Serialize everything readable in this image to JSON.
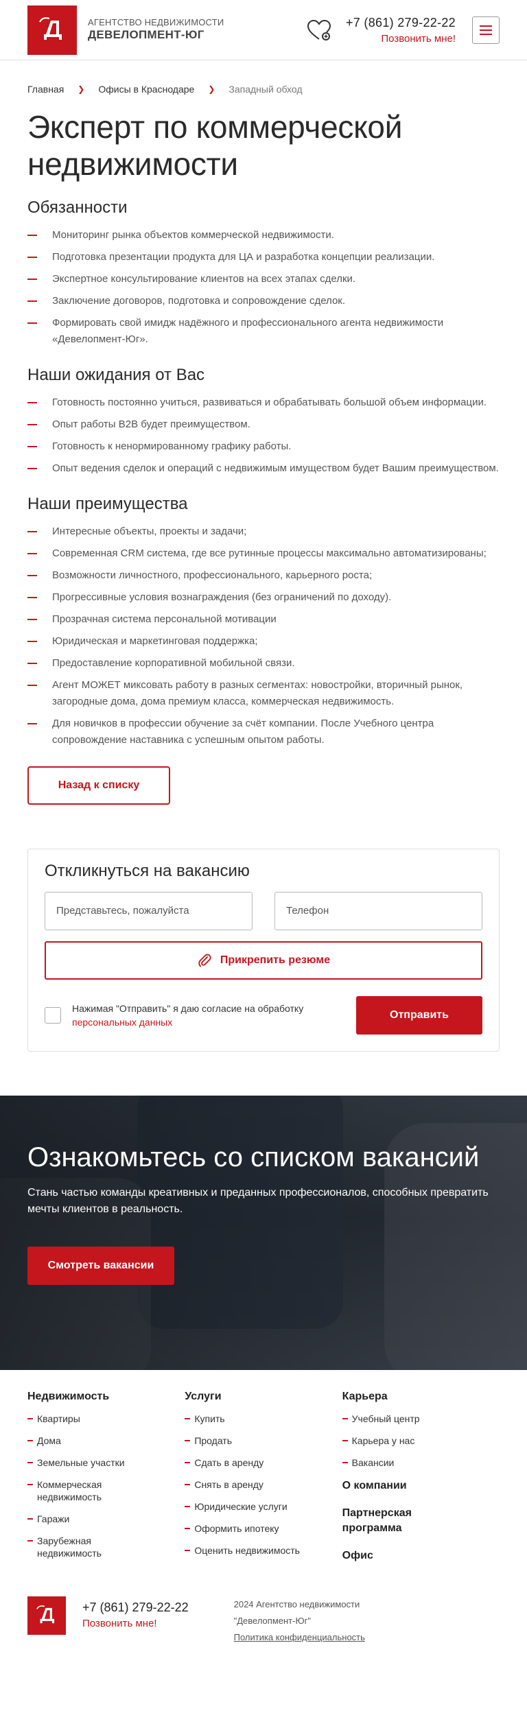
{
  "header": {
    "brand_top": "АГЕНТСТВО НЕДВИЖИМОСТИ",
    "brand_bottom": "ДЕВЕЛОПМЕНТ-ЮГ",
    "phone": "+7 (861) 279-22-22",
    "call_label": "Позвонить мне!",
    "icons": [
      "logo",
      "heart-icon",
      "menu-icon"
    ]
  },
  "breadcrumb": [
    {
      "label": "Главная"
    },
    {
      "label": "Офисы в Краснодаре"
    },
    {
      "label": "Западный обход"
    }
  ],
  "page_title": "Эксперт по коммерческой недвижимости",
  "sections": [
    {
      "title": "Обязанности",
      "items": [
        "Мониторинг рынка объектов коммерческой недвижимости.",
        "Подготовка презентации продукта для ЦА и разработка концепции реализации.",
        "Экспертное консультирование клиентов на всех этапах сделки.",
        "Заключение договоров, подготовка и сопровождение сделок.",
        "Формировать свой имидж надёжного и профессионального агента недвижимости «Девелопмент-Юг»."
      ]
    },
    {
      "title": "Наши ожидания от Вас",
      "items": [
        "Готовность постоянно учиться, развиваться и обрабатывать большой объем информации.",
        "Опыт работы B2B будет преимуществом.",
        "Готовность к ненормированному графику работы.",
        "Опыт ведения сделок и операций с недвижимым имуществом будет Вашим преимуществом."
      ]
    },
    {
      "title": "Наши преимущества",
      "items": [
        "Интересные объекты, проекты и задачи;",
        "Современная CRM система, где все рутинные процессы максимально автоматизированы;",
        "Возможности личностного, профессионального, карьерного роста;",
        "Прогрессивные условия вознаграждения (без ограничений по доходу).",
        "Прозрачная система персональной мотивации",
        "Юридическая и маркетинговая поддержка;",
        "Предоставление корпоративной мобильной связи.",
        "Агент МОЖЕТ миксовать работу в разных сегментах: новостройки, вторичный рынок, загородные дома, дома премиум класса, коммерческая недвижимость.",
        "Для новичков в профессии обучение за счёт компании. После Учебного центра сопровождение наставника с успешным опытом работы."
      ]
    }
  ],
  "back_button": "Назад к списку",
  "form": {
    "title": "Откликнуться на вакансию",
    "name_placeholder": "Представьтесь, пожалуйста",
    "phone_placeholder": "Телефон",
    "attach_label": "Прикрепить резюме",
    "consent_text": "Нажимая \"Отправить\" я даю согласие на обработку",
    "consent_link": "персональных данных",
    "submit_label": "Отправить"
  },
  "hero": {
    "title": "Ознакомьтесь со списком вакансий",
    "text": "Стань частью команды креативных и преданных профессионалов, способных превратить мечты клиентов в реальность.",
    "button": "Смотреть вакансии"
  },
  "footer": {
    "col1": {
      "title": "Недвижимость",
      "items": [
        "Квартиры",
        "Дома",
        "Земельные участки",
        "Коммерческая недвижимость",
        "Гаражи",
        "Зарубежная недвижимость"
      ]
    },
    "col2": {
      "title": "Услуги",
      "items": [
        "Купить",
        "Продать",
        "Сдать в аренду",
        "Снять в аренду",
        "Юридические услуги",
        "Оформить ипотеку",
        "Оценить недвижимость"
      ]
    },
    "col3": {
      "title": "Карьера",
      "items": [
        "Учебный центр",
        "Карьера у нас",
        "Вакансии"
      ],
      "extra": [
        "О компании",
        "Партнерская программа",
        "Офис"
      ]
    },
    "phone": "+7 (861) 279-22-22",
    "call_label": "Позвонить мне!",
    "copyright_line1": "2024 Агентство недвижимости",
    "copyright_line2": "\"Девелопмент-Юг\"",
    "privacy": "Политика конфиденциальность"
  },
  "colors": {
    "accent": "#c4161c",
    "text": "#3a3a3a"
  }
}
